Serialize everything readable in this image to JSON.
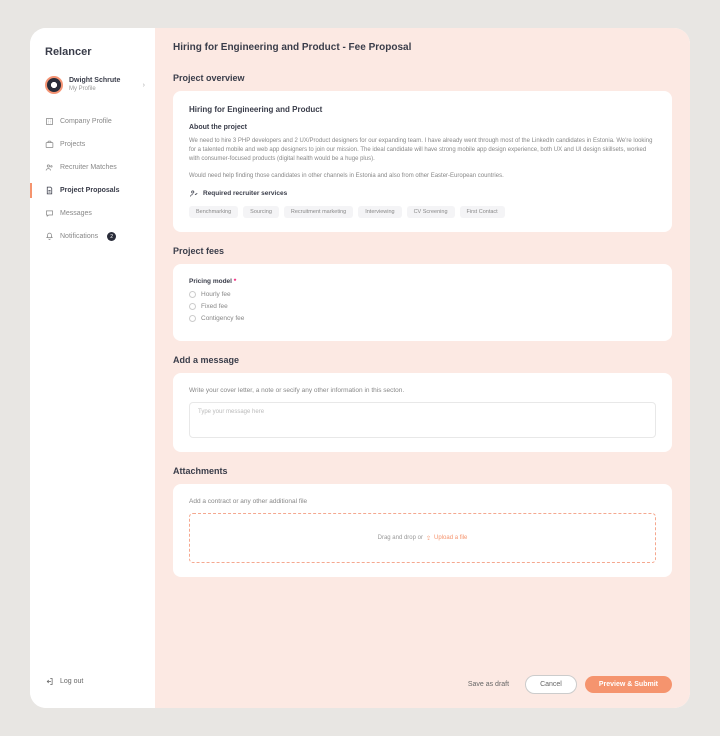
{
  "brand": "Relancer",
  "profile": {
    "name": "Dwight Schrute",
    "sub": "My Profile"
  },
  "nav": {
    "company": "Company Profile",
    "projects": "Projects",
    "matches": "Recruiter Matches",
    "proposals": "Project Proposals",
    "messages": "Messages",
    "notifications": "Notifications",
    "notif_count": "2"
  },
  "logout": "Log out",
  "title": "Hiring for Engineering and Product  - Fee Proposal",
  "overview": {
    "heading": "Project overview",
    "project_title": "Hiring for Engineering and Product",
    "about_label": "About the project",
    "p1": "We need to hire 3 PHP developers and 2 UX/Product designers for our expanding team. I have already went through most of the LinkedIn candidates in Estonia. We're looking for a talented mobile and web app designers to join our mission. The ideal candidate will have strong mobile app design experience, both UX and UI design skillsets, worked with consumer-focused products (digital health would be a huge plus).",
    "p2": "Would need help finding those candidates in other channels in Estonia and also from other Easter-European countries.",
    "req_label": "Required recruiter services",
    "tags": [
      "Benchmarking",
      "Sourcing",
      "Recruitment marketing",
      "Interviewing",
      "CV Screening",
      "First Contact"
    ]
  },
  "fees": {
    "heading": "Project fees",
    "pricing_label": "Pricing model",
    "options": [
      "Hourly fee",
      "Fixed fee",
      "Contigency fee"
    ]
  },
  "message": {
    "heading": "Add a message",
    "helper": "Write your cover letter, a note or secify any other information in this secton.",
    "placeholder": "Type your message here"
  },
  "attachments": {
    "heading": "Attachments",
    "helper": "Add a contract or any other additional file",
    "drop_prefix": "Drag and drop or",
    "upload": "Upload a file"
  },
  "actions": {
    "draft": "Save as draft",
    "cancel": "Cancel",
    "submit": "Preview & Submit"
  }
}
